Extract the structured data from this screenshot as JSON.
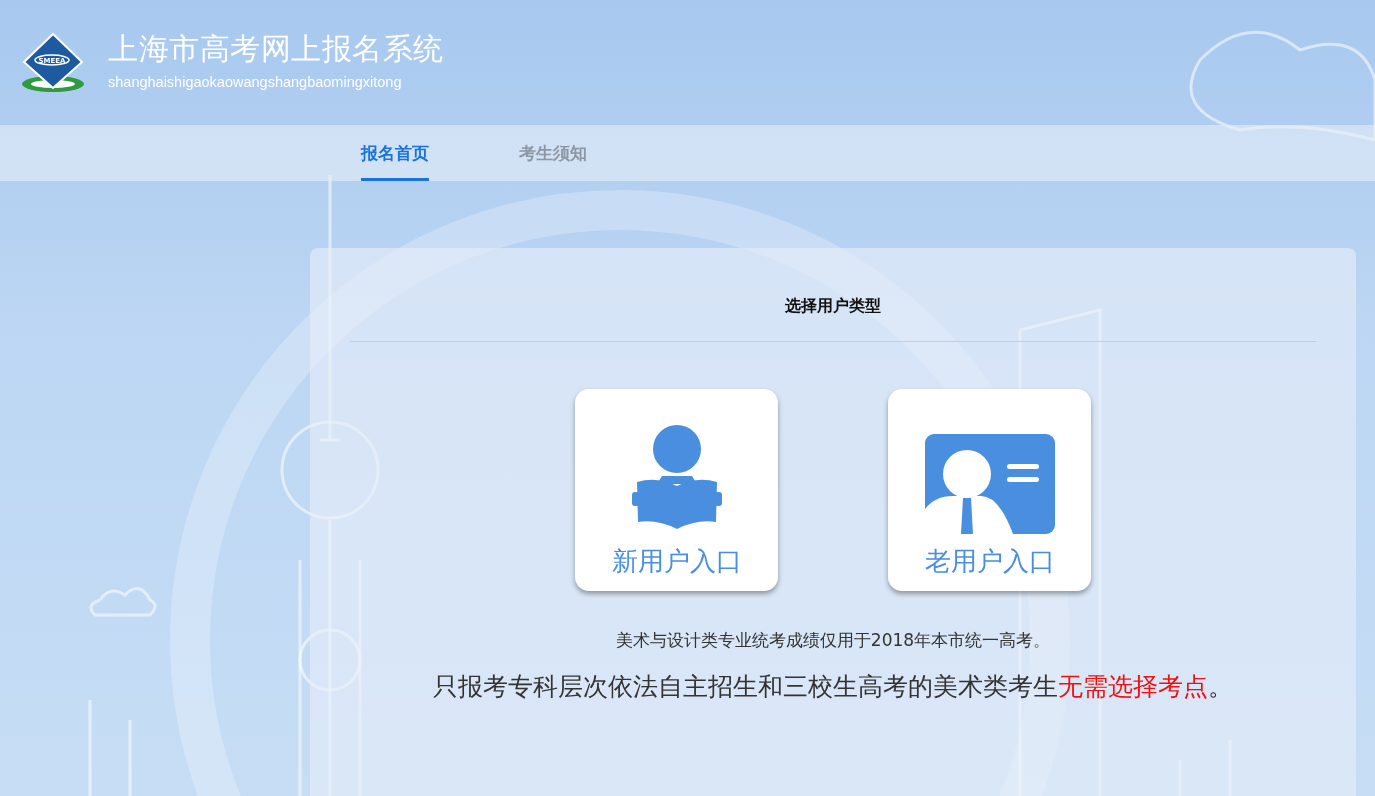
{
  "header": {
    "logo_text": "SMEEA",
    "title": "上海市高考网上报名系统",
    "subtitle": "shanghaishigaokaowangshangbaomingxitong"
  },
  "nav": {
    "tabs": [
      {
        "label": "报名首页",
        "selected": true
      },
      {
        "label": "考生须知",
        "selected": false
      }
    ]
  },
  "panel": {
    "title": "选择用户类型",
    "entries": [
      {
        "kind": "new",
        "label": "新用户入口"
      },
      {
        "kind": "returning",
        "label": "老用户入口"
      }
    ],
    "note": "美术与设计类专业统考成绩仅用于2018年本市统一高考。",
    "notice": [
      {
        "text": "只报考专科层次依法自主招生和三校生高考的美术类考生",
        "emphasis": false
      },
      {
        "text": "无需选择考点",
        "emphasis": true
      },
      {
        "text": "。",
        "emphasis": false
      }
    ]
  }
}
